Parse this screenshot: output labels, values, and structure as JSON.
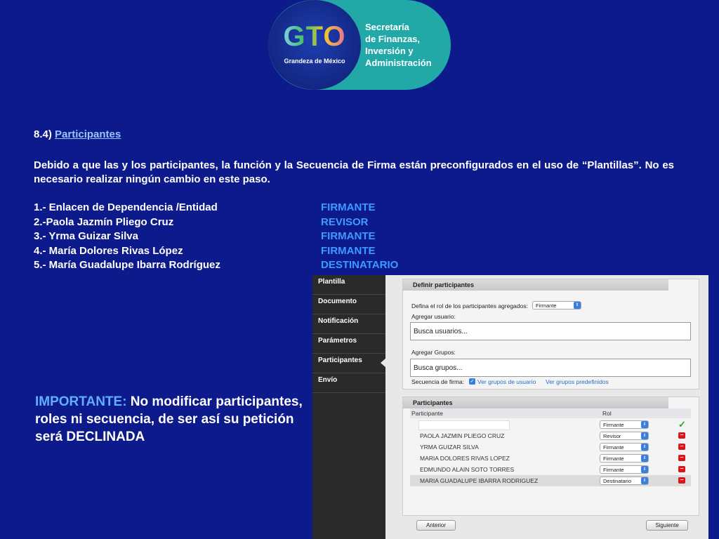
{
  "logo": {
    "brand": "GTO",
    "tagline": "Grandeza de México",
    "org_lines": [
      "Secretaría",
      "de Finanzas,",
      "Inversión y",
      "Administración"
    ]
  },
  "section": {
    "number": "8.4)",
    "title": "Participantes"
  },
  "paragraph": "Debido a que las y los participantes, la función y la Secuencia de Firma están preconfigurados en el uso de “Plantillas”. No es necesario realizar ningún cambio en este paso.",
  "participants_list": [
    {
      "name": "1.- Enlacen de Dependencia /Entidad",
      "role": "FIRMANTE"
    },
    {
      "name": "2.-Paola Jazmín Pliego Cruz",
      "role": "REVISOR"
    },
    {
      "name": "3.- Yrma Guizar Silva",
      "role": "FIRMANTE"
    },
    {
      "name": "4.- María Dolores Rivas López",
      "role": "FIRMANTE"
    },
    {
      "name": "5.- María Guadalupe Ibarra Rodríguez",
      "role": "DESTINATARIO"
    }
  ],
  "important": {
    "highlight": "IMPORTANTE:",
    "rest": " No modificar participantes, roles ni secuencia, de ser así su petición será DECLINADA"
  },
  "app": {
    "nav": [
      "Plantilla",
      "Documento",
      "Notificación",
      "Parámetros",
      "Participantes",
      "Envío"
    ],
    "active_nav": "Participantes",
    "define_panel": {
      "title": "Definir participantes",
      "role_label": "Defina el rol de los participantes agregados:",
      "role_value": "Firmante",
      "add_user_label": "Agregar usuario:",
      "user_placeholder": "Busca usuarios...",
      "add_group_label": "Agregar Grupos:",
      "group_placeholder": "Busca grupos...",
      "sequence_label": "Secuencia de firma:",
      "link_user_groups": "Ver grupos de usuario",
      "link_predefined": "Ver grupos predefinidos"
    },
    "participants_panel": {
      "title": "Participantes",
      "col_participant": "Participante",
      "col_role": "Rol",
      "rows": [
        {
          "name": "",
          "role": "Firmante",
          "action": "check"
        },
        {
          "name": "PAOLA JAZMIN PLIEGO CRUZ",
          "role": "Revisor",
          "action": "remove"
        },
        {
          "name": "YRMA GUIZAR SILVA",
          "role": "Firmante",
          "action": "remove"
        },
        {
          "name": "MARIA DOLORES RIVAS LOPEZ",
          "role": "Firmante",
          "action": "remove"
        },
        {
          "name": "EDMUNDO ALAIN SOTO TORRES",
          "role": "Firmante",
          "action": "remove"
        },
        {
          "name": "MARIA GUADALUPE IBARRA RODRIGUEZ",
          "role": "Destinatario",
          "action": "remove"
        }
      ]
    },
    "buttons": {
      "prev": "Anterior",
      "next": "Siguiente"
    }
  },
  "colors": {
    "background": "#0c1a8c",
    "accent_blue": "#3d9bff",
    "teal": "#23a8a8"
  }
}
